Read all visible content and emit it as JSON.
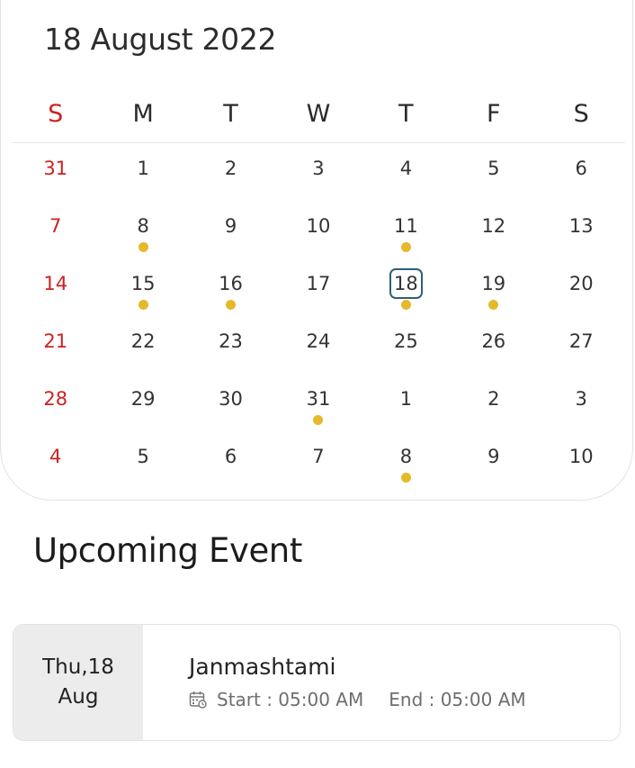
{
  "calendar": {
    "title": "18 August 2022",
    "weekdays": [
      "S",
      "M",
      "T",
      "W",
      "T",
      "F",
      "S"
    ],
    "weeks": [
      [
        "31",
        "1",
        "2",
        "3",
        "4",
        "5",
        "6"
      ],
      [
        "7",
        "8",
        "9",
        "10",
        "11",
        "12",
        "13"
      ],
      [
        "14",
        "15",
        "16",
        "17",
        "18",
        "19",
        "20"
      ],
      [
        "21",
        "22",
        "23",
        "24",
        "25",
        "26",
        "27"
      ],
      [
        "28",
        "29",
        "30",
        "31",
        "1",
        "2",
        "3"
      ],
      [
        "4",
        "5",
        "6",
        "7",
        "8",
        "9",
        "10"
      ]
    ],
    "selected_day": "18",
    "event_days": [
      "8",
      "11",
      "15",
      "16",
      "18",
      "19",
      "31",
      "Sep 8"
    ],
    "colors": {
      "sunday": "#cc2222",
      "event_dot": "#e5b92a",
      "selected_border": "#2e5f7a"
    }
  },
  "upcoming": {
    "title": "Upcoming Event",
    "event": {
      "date_line1": "Thu,18",
      "date_line2": "Aug",
      "name": "Janmashtami",
      "start": "Start : 05:00 AM",
      "end": "End : 05:00 AM",
      "icon": "calendar-clock-icon"
    }
  }
}
